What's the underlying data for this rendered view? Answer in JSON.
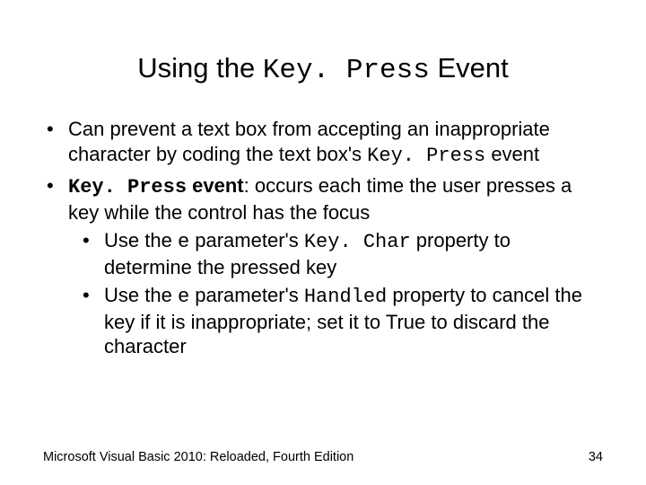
{
  "title": {
    "prefix": "Using the ",
    "mono": "Key. Press",
    "suffix": " Event"
  },
  "bullets": [
    {
      "runs": [
        {
          "t": "Can prevent a text box from accepting an inappropriate character by coding the text box's "
        },
        {
          "t": "Key. Press",
          "class": "mono"
        },
        {
          "t": " event"
        }
      ]
    },
    {
      "runs": [
        {
          "t": "Key. Press",
          "class": "mono bold"
        },
        {
          "t": " event",
          "class": "bold"
        },
        {
          "t": ": occurs each time the user presses a key while the control has the focus"
        }
      ],
      "sub": [
        {
          "runs": [
            {
              "t": "Use the "
            },
            {
              "t": "e",
              "class": "mono"
            },
            {
              "t": " parameter's "
            },
            {
              "t": "Key. Char",
              "class": "mono"
            },
            {
              "t": " property to determine the pressed key"
            }
          ]
        },
        {
          "runs": [
            {
              "t": "Use the "
            },
            {
              "t": "e",
              "class": "mono"
            },
            {
              "t": " parameter's "
            },
            {
              "t": "Handled",
              "class": "mono"
            },
            {
              "t": " property to cancel the key if it is inappropriate; set it to True to discard the character"
            }
          ]
        }
      ]
    }
  ],
  "footer": {
    "left": "Microsoft Visual Basic 2010: Reloaded, Fourth Edition",
    "page": "34"
  }
}
